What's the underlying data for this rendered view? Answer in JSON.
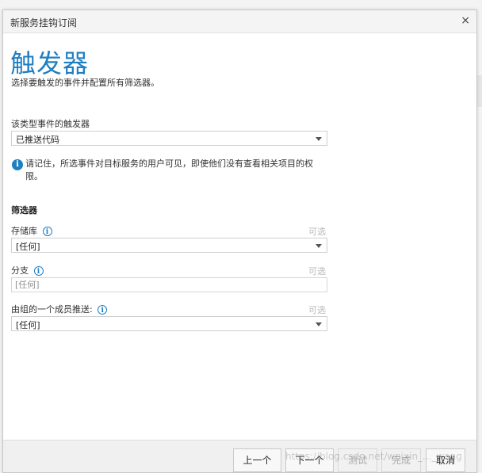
{
  "dialog": {
    "title": "新服务挂钩订阅",
    "close_glyph": "×"
  },
  "header": {
    "heading": "触发器",
    "subheading": "选择要触发的事件并配置所有筛选器。"
  },
  "trigger": {
    "label": "该类型事件的触发器",
    "selected": "已推送代码"
  },
  "note": {
    "text": "请记住，所选事件对目标服务的用户可见，即使他们没有查看相关项目的权限。"
  },
  "filters": {
    "section_title": "筛选器",
    "optional_label": "可选",
    "repository": {
      "label": "存储库",
      "selected": "[任何]"
    },
    "branch": {
      "label": "分支",
      "placeholder": "[任何]"
    },
    "member_group": {
      "label": "由组的一个成员推送:",
      "selected": "[任何]"
    }
  },
  "footer": {
    "prev": "上一个",
    "next": "下一个",
    "test": "测试",
    "finish": "完成",
    "cancel": "取消"
  },
  "watermark": "https://blog.csdn.net/weixin_..._wang"
}
